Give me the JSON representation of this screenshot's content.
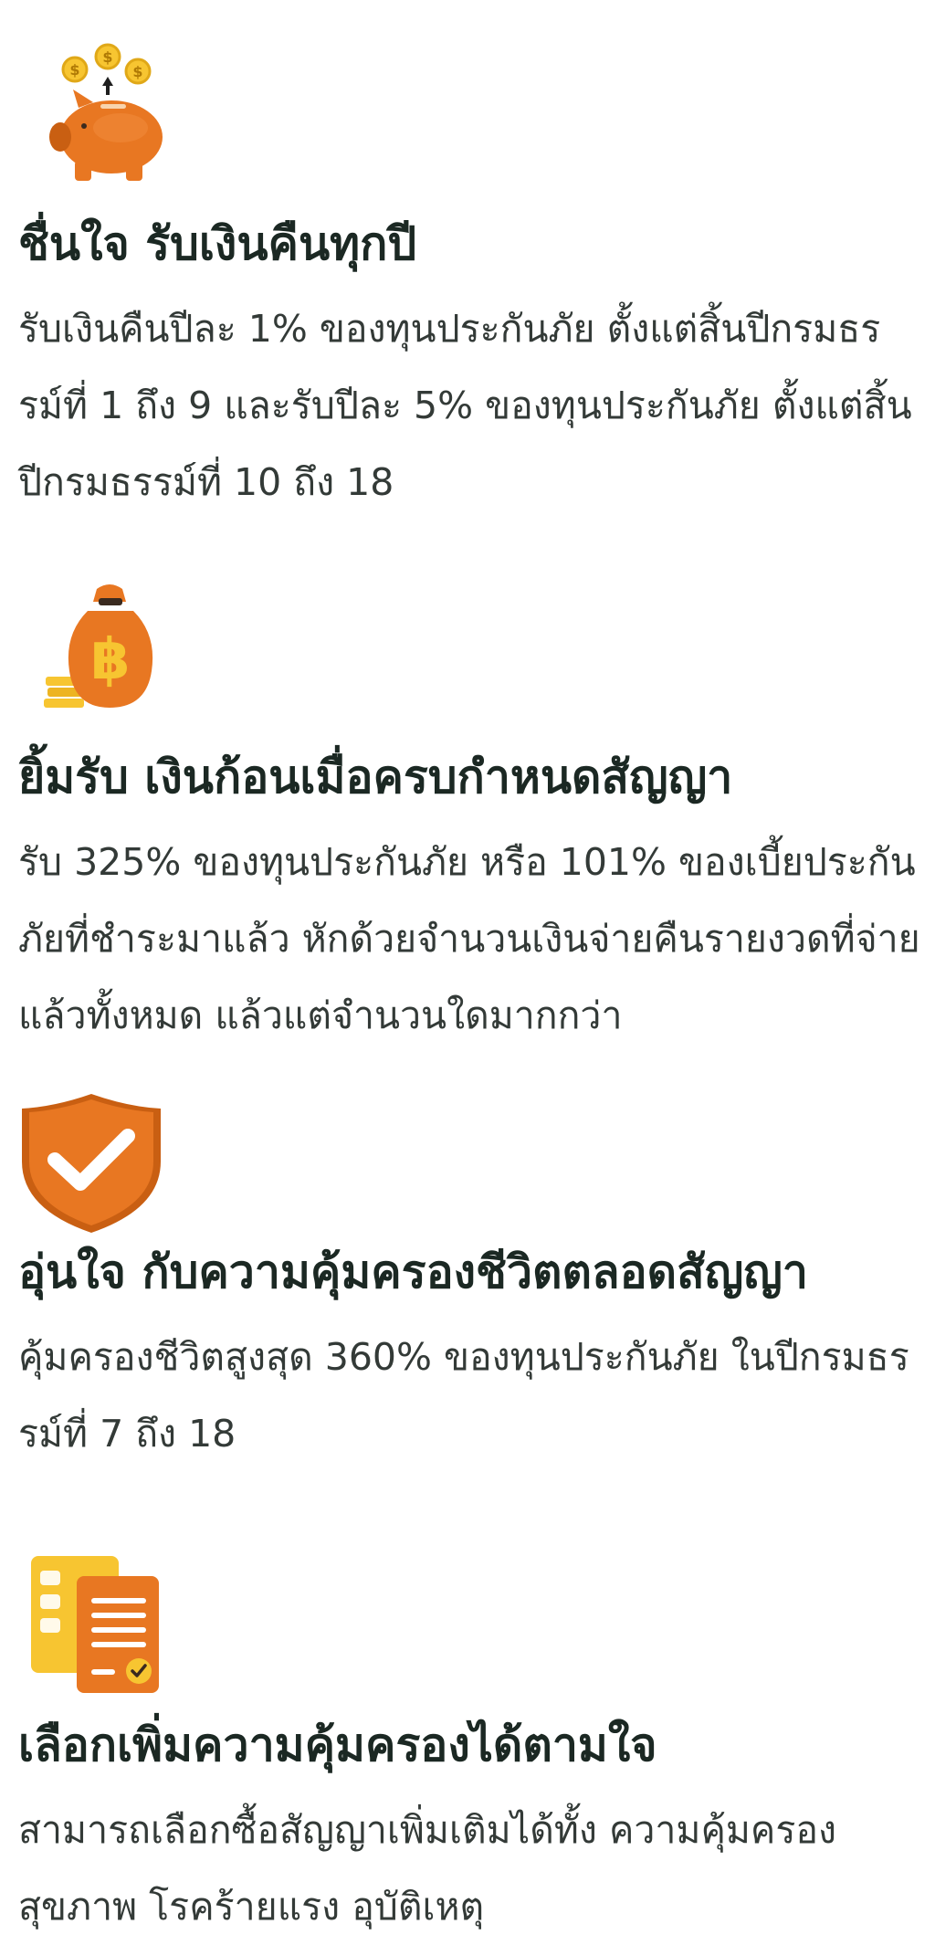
{
  "colors": {
    "accent_orange": "#E87722",
    "accent_orange_dark": "#C95F12",
    "coin_yellow": "#F7C531",
    "heading_text": "#1B2823",
    "body_text": "#333A37"
  },
  "features": [
    {
      "icon": "piggy-bank-icon",
      "title": "ชื่นใจ รับเงินคืนทุกปี",
      "description": "รับเงินคืนปีละ 1% ของทุนประกันภัย ตั้งแต่สิ้นปีกรมธรรม์ที่ 1 ถึง 9 และรับปีละ 5% ของทุนประกันภัย ตั้งแต่สิ้นปีกรมธรรม์ที่ 10 ถึง 18"
    },
    {
      "icon": "money-bag-icon",
      "title": "ยิ้มรับ เงินก้อนเมื่อครบกำหนดสัญญา",
      "description": "รับ 325% ของทุนประกันภัย หรือ 101% ของเบี้ยประกันภัยที่ชำระมาแล้ว หักด้วยจำนวนเงินจ่ายคืนรายงวดที่จ่ายแล้วทั้งหมด แล้วแต่จำนวนใดมากกว่า"
    },
    {
      "icon": "shield-check-icon",
      "title": "อุ่นใจ กับความคุ้มครองชีวิตตลอดสัญญา",
      "description": "คุ้มครองชีวิตสูงสุด 360% ของทุนประกันภัย ในปีกรมธรรม์ที่ 7 ถึง 18"
    },
    {
      "icon": "documents-icon",
      "title": "เลือกเพิ่มความคุ้มครองได้ตามใจ",
      "description": "สามารถเลือกซื้อสัญญาเพิ่มเติมได้ทั้ง ความคุ้มครองสุขภาพ โรคร้ายแรง อุบัติเหตุ"
    }
  ]
}
